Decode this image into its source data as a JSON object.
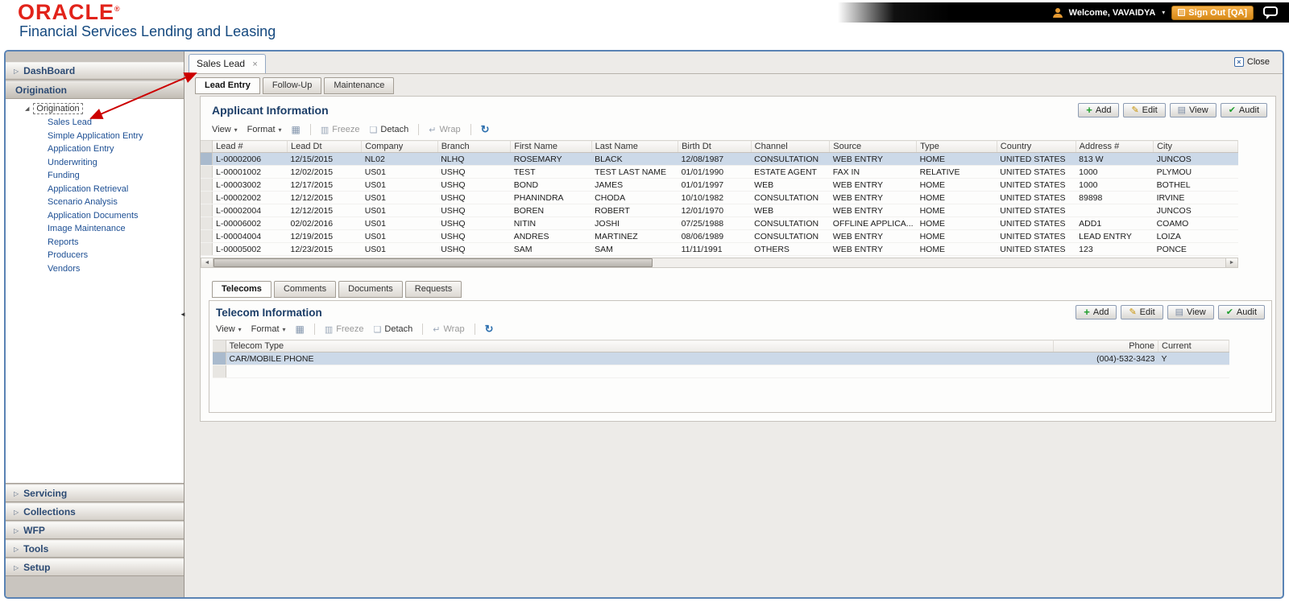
{
  "header": {
    "logo": "ORACLE",
    "subtitle": "Financial Services Lending and Leasing",
    "welcome": "Welcome, VAVAIDYA",
    "sign_out": "Sign Out [QA]"
  },
  "sidebar": {
    "sections_top": [
      {
        "label": "DashBoard"
      }
    ],
    "origination_header": "Origination",
    "tree_root": "Origination",
    "tree_items": [
      "Sales Lead",
      "Simple Application Entry",
      "Application Entry",
      "Underwriting",
      "Funding",
      "Application Retrieval",
      "Scenario Analysis",
      "Application Documents",
      "Image Maintenance",
      "Reports",
      "Producers",
      "Vendors"
    ],
    "selected_item": "Sales Lead",
    "sections_bottom": [
      "Servicing",
      "Collections",
      "WFP",
      "Tools",
      "Setup"
    ]
  },
  "main": {
    "window_tab": "Sales Lead",
    "close_label": "Close",
    "tabs": [
      {
        "label": "Lead Entry",
        "active": true
      },
      {
        "label": "Follow-Up",
        "active": false
      },
      {
        "label": "Maintenance",
        "active": false
      }
    ],
    "applicant": {
      "title": "Applicant Information",
      "actions": [
        "Add",
        "Edit",
        "View",
        "Audit"
      ],
      "toolbar": {
        "view": "View",
        "format": "Format",
        "freeze": "Freeze",
        "detach": "Detach",
        "wrap": "Wrap"
      },
      "columns": [
        "Lead #",
        "Lead Dt",
        "Company",
        "Branch",
        "First Name",
        "Last Name",
        "Birth Dt",
        "Channel",
        "Source",
        "Type",
        "Country",
        "Address #",
        "City"
      ],
      "rows": [
        [
          "L-00002006",
          "12/15/2015",
          "NL02",
          "NLHQ",
          "ROSEMARY",
          "BLACK",
          "12/08/1987",
          "CONSULTATION",
          "WEB ENTRY",
          "HOME",
          "UNITED STATES",
          "813 W",
          "JUNCOS"
        ],
        [
          "L-00001002",
          "12/02/2015",
          "US01",
          "USHQ",
          "TEST",
          "TEST LAST NAME",
          "01/01/1990",
          "ESTATE AGENT",
          "FAX IN",
          "RELATIVE",
          "UNITED STATES",
          "1000",
          "PLYMOU"
        ],
        [
          "L-00003002",
          "12/17/2015",
          "US01",
          "USHQ",
          "BOND",
          "JAMES",
          "01/01/1997",
          "WEB",
          "WEB ENTRY",
          "HOME",
          "UNITED STATES",
          "1000",
          "BOTHEL"
        ],
        [
          "L-00002002",
          "12/12/2015",
          "US01",
          "USHQ",
          "PHANINDRA",
          "CHODA",
          "10/10/1982",
          "CONSULTATION",
          "WEB ENTRY",
          "HOME",
          "UNITED STATES",
          "89898",
          "IRVINE"
        ],
        [
          "L-00002004",
          "12/12/2015",
          "US01",
          "USHQ",
          "BOREN",
          "ROBERT",
          "12/01/1970",
          "WEB",
          "WEB ENTRY",
          "HOME",
          "UNITED STATES",
          "",
          "JUNCOS"
        ],
        [
          "L-00006002",
          "02/02/2016",
          "US01",
          "USHQ",
          "NITIN",
          "JOSHI",
          "07/25/1988",
          "CONSULTATION",
          "OFFLINE APPLICA...",
          "HOME",
          "UNITED STATES",
          "ADD1",
          "COAMO"
        ],
        [
          "L-00004004",
          "12/19/2015",
          "US01",
          "USHQ",
          "ANDRES",
          "MARTINEZ",
          "08/06/1989",
          "CONSULTATION",
          "WEB ENTRY",
          "HOME",
          "UNITED STATES",
          "LEAD ENTRY",
          "LOIZA"
        ],
        [
          "L-00005002",
          "12/23/2015",
          "US01",
          "USHQ",
          "SAM",
          "SAM",
          "11/11/1991",
          "OTHERS",
          "WEB ENTRY",
          "HOME",
          "UNITED STATES",
          "123",
          "PONCE"
        ]
      ],
      "selected_row": 0
    },
    "detail_tabs": [
      {
        "label": "Telecoms",
        "active": true
      },
      {
        "label": "Comments",
        "active": false
      },
      {
        "label": "Documents",
        "active": false
      },
      {
        "label": "Requests",
        "active": false
      }
    ],
    "telecom": {
      "title": "Telecom Information",
      "actions": [
        "Add",
        "Edit",
        "View",
        "Audit"
      ],
      "toolbar": {
        "view": "View",
        "format": "Format",
        "freeze": "Freeze",
        "detach": "Detach",
        "wrap": "Wrap"
      },
      "columns": [
        "Telecom Type",
        "Phone",
        "Current"
      ],
      "rows": [
        [
          "CAR/MOBILE PHONE",
          "(004)-532-3423",
          "Y"
        ]
      ],
      "selected_row": 0
    }
  },
  "colors": {
    "oracle_red": "#e2231a",
    "subtitle_blue": "#15497f",
    "accent_orange": "#e59a33",
    "selected_row": "#ccd9e8",
    "frame_border": "#5a83b4",
    "annotation_red": "#cc0000"
  }
}
